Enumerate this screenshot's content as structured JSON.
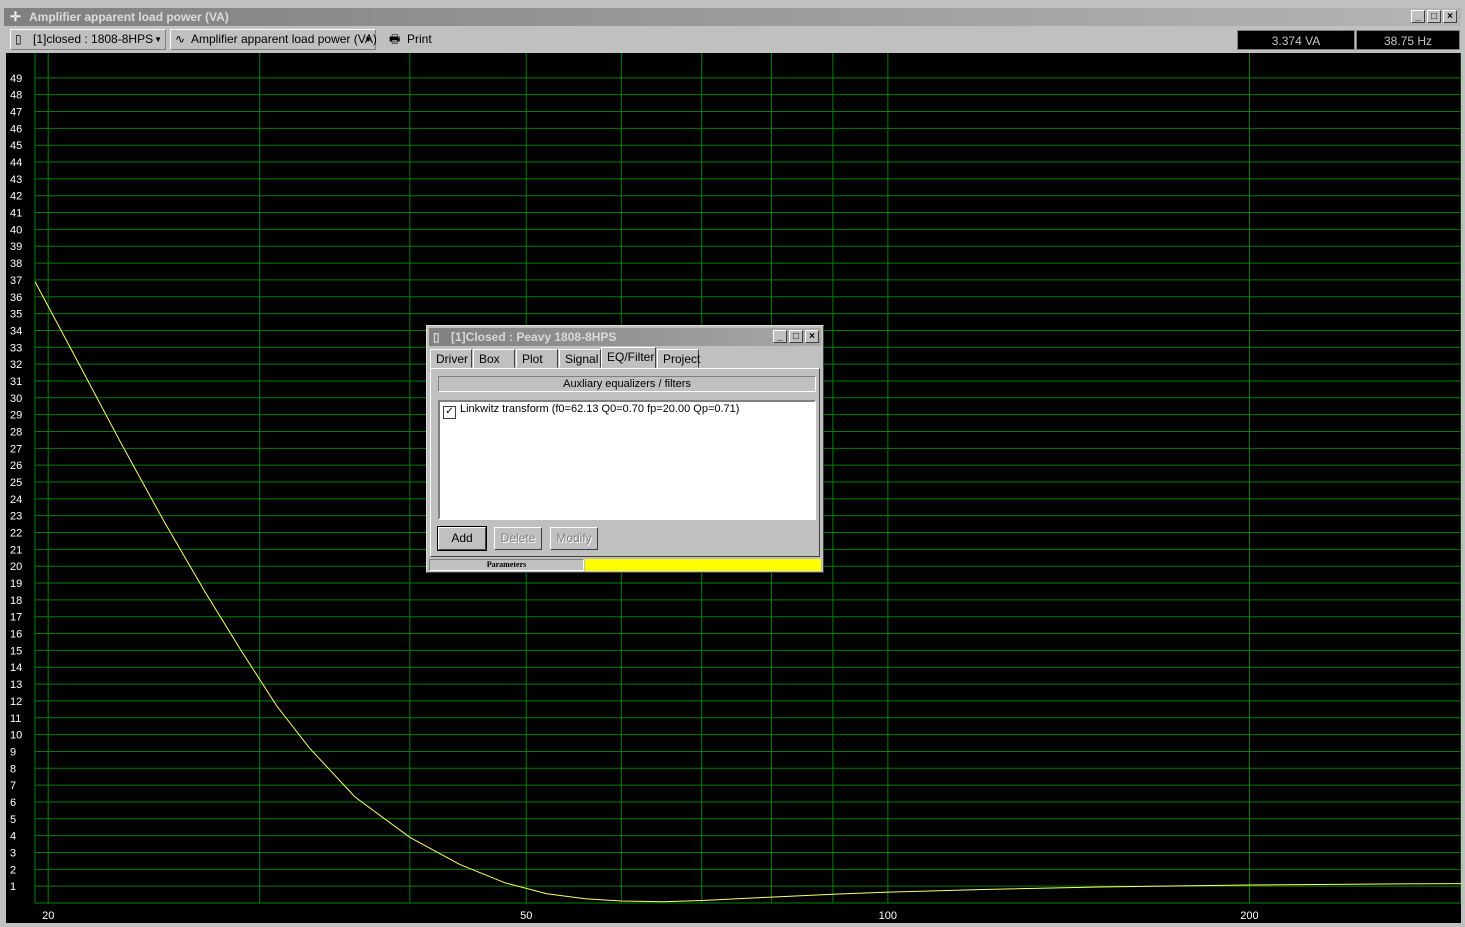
{
  "window": {
    "title": "Amplifier apparent load power (VA)",
    "title_icon": "crosshair-icon",
    "controls": [
      "_",
      "□",
      "×"
    ]
  },
  "toolbar": {
    "enclosure_combo": "[1]closed : 1808-8HPS",
    "graph_combo": "Amplifier apparent load power (VA)",
    "print_label": "Print",
    "power_readout": "3.374 VA",
    "freq_readout": "38.75 Hz"
  },
  "chart_data": {
    "type": "line",
    "title": "",
    "xlabel": "",
    "ylabel": "",
    "x_scale": "log",
    "xlim": [
      19.5,
      300
    ],
    "ylim": [
      0,
      50
    ],
    "x_tick_labels": [
      "20",
      "50",
      "100",
      "200"
    ],
    "y_ticks": [
      1,
      2,
      3,
      4,
      5,
      6,
      7,
      8,
      9,
      10,
      11,
      12,
      13,
      14,
      15,
      16,
      17,
      18,
      19,
      20,
      21,
      22,
      23,
      24,
      25,
      26,
      27,
      28,
      29,
      30,
      31,
      32,
      33,
      34,
      35,
      36,
      37,
      38,
      39,
      40,
      41,
      42,
      43,
      44,
      45,
      46,
      47,
      48,
      49
    ],
    "grid": true,
    "background": "#000000",
    "grid_color": "#008000",
    "series": [
      {
        "color": "#ffff66",
        "x": [
          19.5,
          21,
          23,
          25,
          27,
          29,
          31,
          33,
          36,
          40,
          44,
          48,
          52,
          56,
          60,
          65,
          70,
          80,
          90,
          100,
          120,
          150,
          200,
          250,
          300
        ],
        "y": [
          36.9,
          32.6,
          27.3,
          22.6,
          18.5,
          14.9,
          11.7,
          9.2,
          6.3,
          3.9,
          2.3,
          1.2,
          0.55,
          0.25,
          0.12,
          0.08,
          0.15,
          0.35,
          0.52,
          0.65,
          0.8,
          0.95,
          1.07,
          1.12,
          1.15
        ]
      }
    ]
  },
  "dialog": {
    "title": "[1]Closed : Peavy 1808-8HPS",
    "tabs": [
      "Driver",
      "Box",
      "Plot",
      "Signal",
      "EQ/Filter",
      "Project"
    ],
    "active_tab": "EQ/Filter",
    "section_header": "Auxliary equalizers / filters",
    "filters": [
      {
        "checked": true,
        "label": "Linkwitz transform (f0=62.13 Q0=0.70 fp=20.00 Qp=0.71)"
      }
    ],
    "buttons": {
      "add": "Add",
      "delete": "Delete",
      "modify": "Modify"
    },
    "status_label": "Parameters",
    "status_color": "#ffff00"
  }
}
